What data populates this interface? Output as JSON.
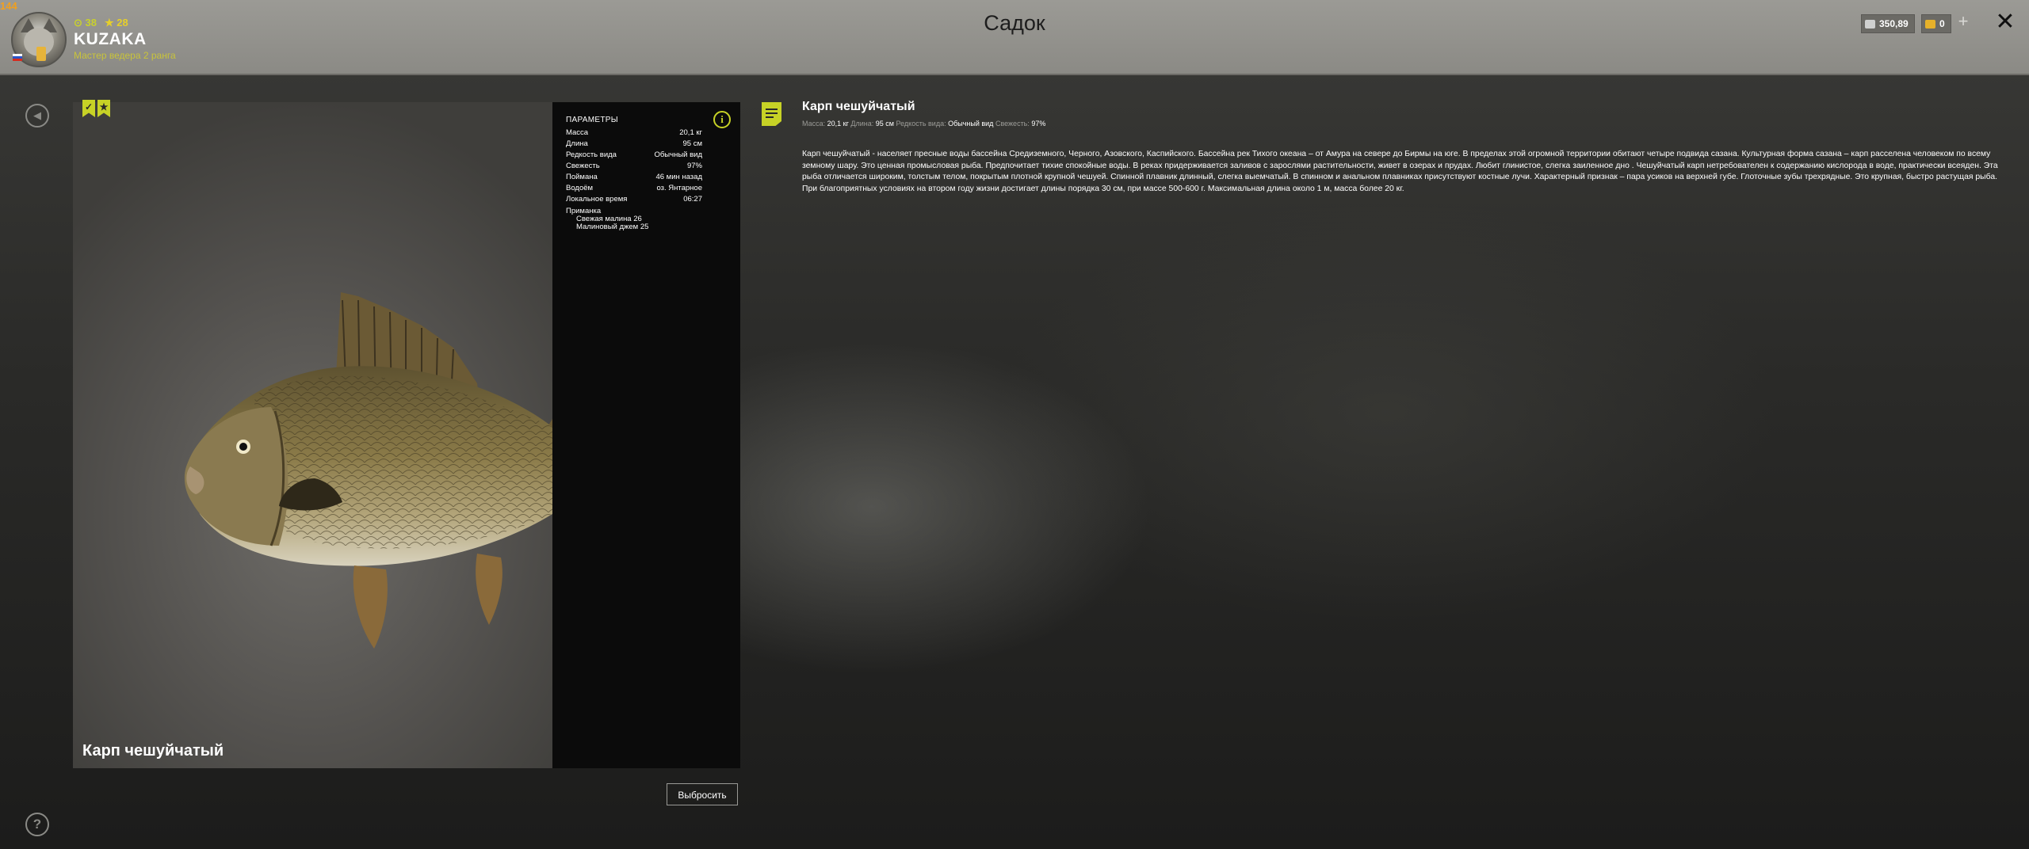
{
  "fps_counter": "144",
  "player": {
    "level": "38",
    "stars": "28",
    "name": "KUZAKA",
    "rank": "Мастер ведера 2 ранга"
  },
  "header": {
    "title": "Садок",
    "silver": "350,89",
    "gold": "0",
    "plus_label": "+",
    "close_label": "✕"
  },
  "fish": {
    "name": "Карп чешуйчатый",
    "params_title": "ПАРАМЕТРЫ",
    "params": [
      {
        "label": "Масса",
        "value": "20,1 кг"
      },
      {
        "label": "Длина",
        "value": "95 см"
      },
      {
        "label": "Редкость вида",
        "value": "Обычный вид"
      },
      {
        "label": "Свежесть",
        "value": "97%"
      },
      {
        "label": "Поймана",
        "value": "46 мин назад"
      },
      {
        "label": "Водоём",
        "value": "оз. Янтарное"
      },
      {
        "label": "Локальное время",
        "value": "06:27"
      }
    ],
    "bait_label": "Приманка",
    "baits": [
      "Свежая малина 26",
      "Малиновый джем 25"
    ],
    "discard_label": "Выбросить"
  },
  "description": {
    "title": "Карп чешуйчатый",
    "meta": {
      "mass_label": "Масса:",
      "mass": "20,1 кг",
      "length_label": "Длина:",
      "length": "95 см",
      "rarity_label": "Редкость вида:",
      "rarity": "Обычный вид",
      "fresh_label": "Свежесть:",
      "fresh": "97%"
    },
    "text": "Карп чешуйчатый - населяет пресные воды бассейна Средиземного, Черного, Азовского, Каспийского. Бассейна рек Тихого океана – от Амура на севере до Бирмы на юге. В пределах этой огромной территории обитают четыре подвида сазана. Культурная форма сазана – карп расселена человеком по всему земному шару. Это ценная промысловая рыба. Предпочитает тихие спокойные воды. В реках придерживается заливов с зарослями растительности, живет в озерах и прудах. Любит глинистое, слегка заиленное дно . Чешуйчатый карп нетребователен к содержанию кислорода в воде, практически всеяден. Эта рыба отличается широким, толстым телом, покрытым плотной крупной чешуей. Спинной плавник длинный, слегка выемчатый. В спинном и анальном плавниках присутствуют костные лучи. Характерный признак – пара усиков на верхней губе. Глоточные зубы трехрядные. Это крупная, быстро растущая рыба. При благоприятных условиях на втором году жизни достигает длины порядка 30 см, при массе 500-600 г. Максимальная длина около 1 м, масса более 20 кг."
  },
  "icons": {
    "back": "back-icon",
    "help": "help-icon",
    "info": "info-icon",
    "note": "note-icon",
    "badge": "trophy-badge-icon"
  },
  "colors": {
    "accent": "#c7d226",
    "topbar": "#9b9a95",
    "panel": "#0b0b0b"
  }
}
